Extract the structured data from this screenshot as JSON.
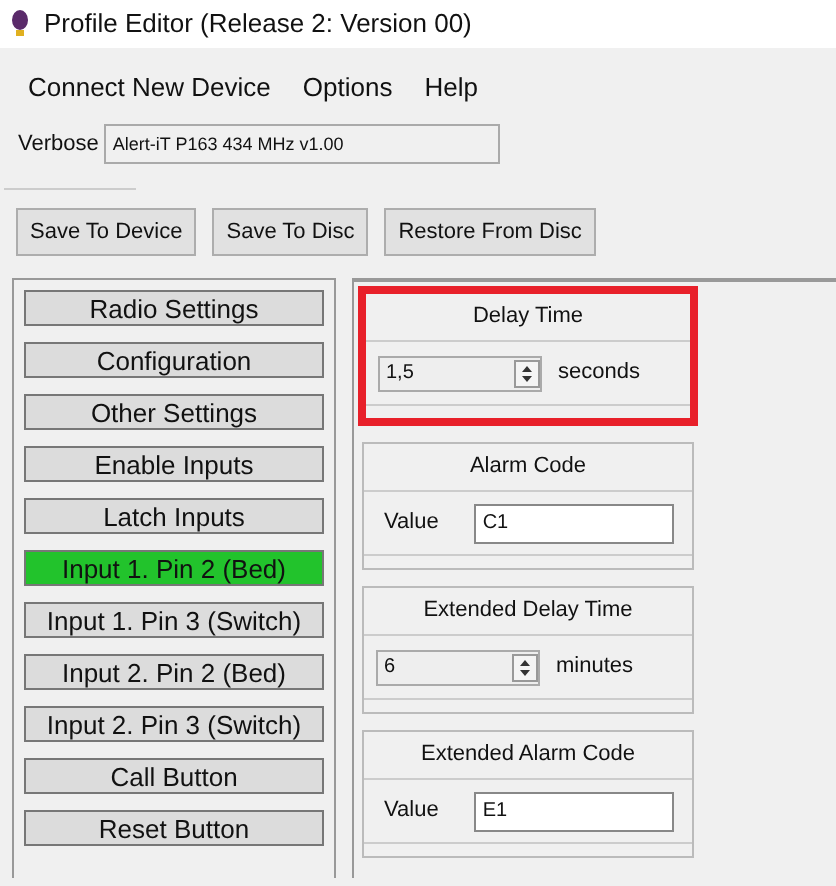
{
  "window": {
    "title": "Profile Editor (Release 2: Version 00)"
  },
  "menu": [
    "Connect New Device",
    "Options",
    "Help"
  ],
  "verbose": {
    "label": "Verbose",
    "value": "Alert-iT P163 434 MHz v1.00"
  },
  "toolbar": [
    "Save To Device",
    "Save To Disc",
    "Restore From Disc"
  ],
  "sidebar": {
    "items": [
      {
        "label": "Radio Settings",
        "selected": false
      },
      {
        "label": "Configuration",
        "selected": false
      },
      {
        "label": "Other Settings",
        "selected": false
      },
      {
        "label": "Enable Inputs",
        "selected": false
      },
      {
        "label": "Latch Inputs",
        "selected": false
      },
      {
        "label": "Input 1. Pin 2 (Bed)",
        "selected": true
      },
      {
        "label": "Input 1. Pin 3 (Switch)",
        "selected": false
      },
      {
        "label": "Input 2. Pin 2 (Bed)",
        "selected": false
      },
      {
        "label": "Input 2. Pin 3 (Switch)",
        "selected": false
      },
      {
        "label": "Call Button",
        "selected": false
      },
      {
        "label": "Reset Button",
        "selected": false
      }
    ]
  },
  "groups": [
    {
      "title": "Delay Time",
      "kind": "spinner",
      "value": "1,5",
      "unit": "seconds",
      "highlighted": true
    },
    {
      "title": "Alarm Code",
      "kind": "text",
      "label": "Value",
      "value": "C1",
      "highlighted": false
    },
    {
      "title": "Extended Delay Time",
      "kind": "spinner",
      "value": "6",
      "unit": "minutes",
      "highlighted": false
    },
    {
      "title": "Extended Alarm Code",
      "kind": "text",
      "label": "Value",
      "value": "E1",
      "highlighted": false
    }
  ]
}
